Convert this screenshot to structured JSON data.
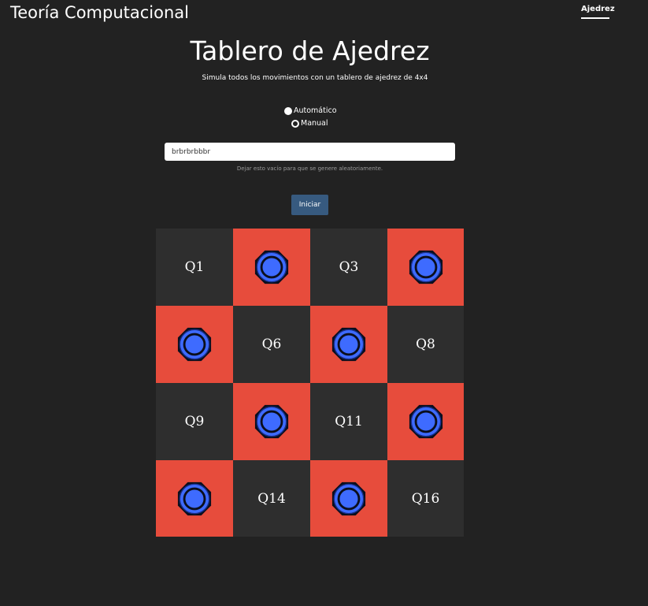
{
  "colors": {
    "background": "#222222",
    "dark_square": "#2e2e2e",
    "red_square": "#e74c3c",
    "button": "#375a7f",
    "piece": "#3e6bff"
  },
  "navbar": {
    "brand": "Teoría Computacional",
    "active_link": "Ajedrez"
  },
  "header": {
    "title": "Tablero de Ajedrez",
    "subtitle": "Simula todos los movimientos con un tablero de ajedrez de 4x4"
  },
  "mode": {
    "options": [
      "Automático",
      "Manual"
    ],
    "selected": "Manual"
  },
  "sequence_input": {
    "value": "brbrbrbbbr"
  },
  "helper_text": "Dejar esto vacío para que se genere aleatoriamente.",
  "start_button": "Iniciar",
  "board": {
    "size": "4x4",
    "cells": [
      {
        "label": "Q1",
        "color": "dark",
        "piece": false
      },
      {
        "label": "",
        "color": "red",
        "piece": true,
        "piece_icon": "blue-token-icon"
      },
      {
        "label": "Q3",
        "color": "dark",
        "piece": false
      },
      {
        "label": "",
        "color": "red",
        "piece": true,
        "piece_icon": "blue-token-icon"
      },
      {
        "label": "",
        "color": "red",
        "piece": true,
        "piece_icon": "blue-token-icon"
      },
      {
        "label": "Q6",
        "color": "dark",
        "piece": false
      },
      {
        "label": "",
        "color": "red",
        "piece": true,
        "piece_icon": "blue-token-icon"
      },
      {
        "label": "Q8",
        "color": "dark",
        "piece": false
      },
      {
        "label": "Q9",
        "color": "dark",
        "piece": false
      },
      {
        "label": "",
        "color": "red",
        "piece": true,
        "piece_icon": "blue-token-icon"
      },
      {
        "label": "Q11",
        "color": "dark",
        "piece": false
      },
      {
        "label": "",
        "color": "red",
        "piece": true,
        "piece_icon": "blue-token-icon"
      },
      {
        "label": "",
        "color": "red",
        "piece": true,
        "piece_icon": "blue-token-icon"
      },
      {
        "label": "Q14",
        "color": "dark",
        "piece": false
      },
      {
        "label": "",
        "color": "red",
        "piece": true,
        "piece_icon": "blue-token-icon"
      },
      {
        "label": "Q16",
        "color": "dark",
        "piece": false
      }
    ]
  }
}
